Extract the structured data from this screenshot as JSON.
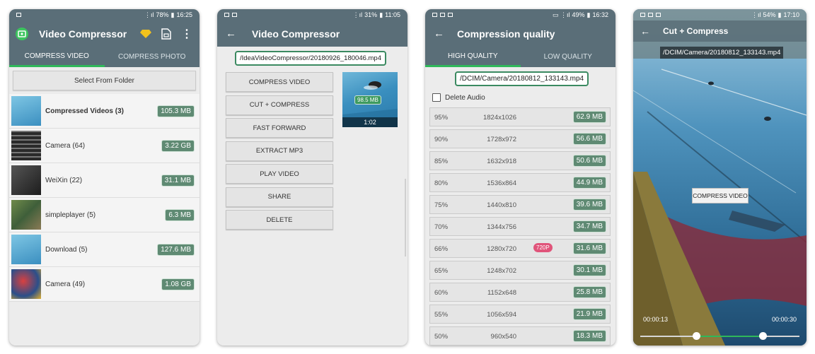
{
  "phone1": {
    "status": {
      "battery": "78%",
      "time": "16:25"
    },
    "title": "Video Compressor",
    "tabs": [
      "COMPRESS VIDEO",
      "COMPRESS PHOTO"
    ],
    "select_folder": "Select From Folder",
    "folders": [
      {
        "name": "Compressed Videos (3)",
        "size": "105.3 MB",
        "bold": true,
        "thumb": "pool"
      },
      {
        "name": "Camera (64)",
        "size": "3.22 GB",
        "thumb": "keyboard"
      },
      {
        "name": "WeiXin (22)",
        "size": "31.1 MB",
        "thumb": "dark"
      },
      {
        "name": "simpleplayer (5)",
        "size": "6.3 MB",
        "thumb": "aerial"
      },
      {
        "name": "Download (5)",
        "size": "127.6 MB",
        "thumb": "pool"
      },
      {
        "name": "Camera (49)",
        "size": "1.08 GB",
        "thumb": "toys"
      }
    ]
  },
  "phone2": {
    "status": {
      "battery": "31%",
      "time": "11:05"
    },
    "title": "Video Compressor",
    "path": "/IdeaVideoCompressor/20180926_180046.mp4",
    "actions": [
      "COMPRESS VIDEO",
      "CUT + COMPRESS",
      "FAST FORWARD",
      "EXTRACT MP3",
      "PLAY VIDEO",
      "SHARE",
      "DELETE"
    ],
    "video_size": "98.5 MB",
    "video_duration": "1:02"
  },
  "phone3": {
    "status": {
      "battery": "49%",
      "time": "16:32"
    },
    "title": "Compression quality",
    "tabs": [
      "HIGH QUALITY",
      "LOW QUALITY"
    ],
    "path": "/DCIM/Camera/20180812_133143.mp4",
    "delete_audio": "Delete Audio",
    "rows": [
      {
        "pct": "95%",
        "res": "1824x1026",
        "size": "62.9 MB"
      },
      {
        "pct": "90%",
        "res": "1728x972",
        "size": "56.6 MB"
      },
      {
        "pct": "85%",
        "res": "1632x918",
        "size": "50.6 MB"
      },
      {
        "pct": "80%",
        "res": "1536x864",
        "size": "44.9 MB"
      },
      {
        "pct": "75%",
        "res": "1440x810",
        "size": "39.6 MB"
      },
      {
        "pct": "70%",
        "res": "1344x756",
        "size": "34.7 MB"
      },
      {
        "pct": "66%",
        "res": "1280x720",
        "size": "31.6 MB",
        "tag": "720P"
      },
      {
        "pct": "65%",
        "res": "1248x702",
        "size": "30.1 MB"
      },
      {
        "pct": "60%",
        "res": "1152x648",
        "size": "25.8 MB"
      },
      {
        "pct": "55%",
        "res": "1056x594",
        "size": "21.9 MB"
      },
      {
        "pct": "50%",
        "res": "960x540",
        "size": "18.3 MB"
      }
    ]
  },
  "phone4": {
    "status": {
      "battery": "54%",
      "time": "17:10"
    },
    "title": "Cut + Compress",
    "path": "/DCIM/Camera/20180812_133143.mp4",
    "compress_button": "COMPRESS VIDEO",
    "start_time": "00:00:13",
    "end_time": "00:00:30"
  }
}
